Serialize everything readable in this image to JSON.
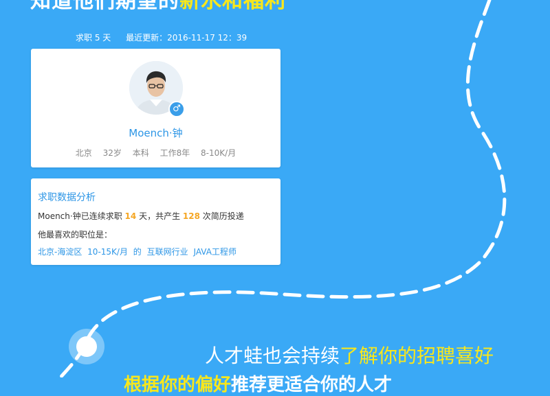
{
  "headline": {
    "white_text": "知道他们期望的",
    "yellow_text": "新水和福利"
  },
  "meta": {
    "job_seeking": "求职 5 天",
    "last_updated": "最近更新：2016-11-17  12：39"
  },
  "profile": {
    "name": "Moench·钟",
    "gender_symbol": "♂",
    "city": "北京",
    "age": "32岁",
    "education": "本科",
    "experience": "工作8年",
    "salary": "8-10K/月"
  },
  "stats": {
    "title": "求职数据分析",
    "line_prefix": "Moench·钟已连续求职",
    "days": "14",
    "line_mid": "天，共产生",
    "resumes": "128",
    "line_suffix": "次简历投递",
    "favorite_label": "他最喜欢的职位是：",
    "job_location": "北京-海淀区",
    "job_salary": "10-15K/月",
    "job_of": "的",
    "job_industry": "互联网行业",
    "job_title": "JAVA工程师"
  },
  "bottom": {
    "white_text": "人才蛙也会持续",
    "yellow_text": "了解你的招聘喜好",
    "second_line_yellow": "根据你的偏好",
    "second_line_white": "推荐更适合你的人才"
  },
  "colors": {
    "background": "#3aa9f6",
    "accent_blue": "#2d96e6",
    "highlight_yellow": "#f8e71c",
    "number_orange": "#f5a623"
  }
}
